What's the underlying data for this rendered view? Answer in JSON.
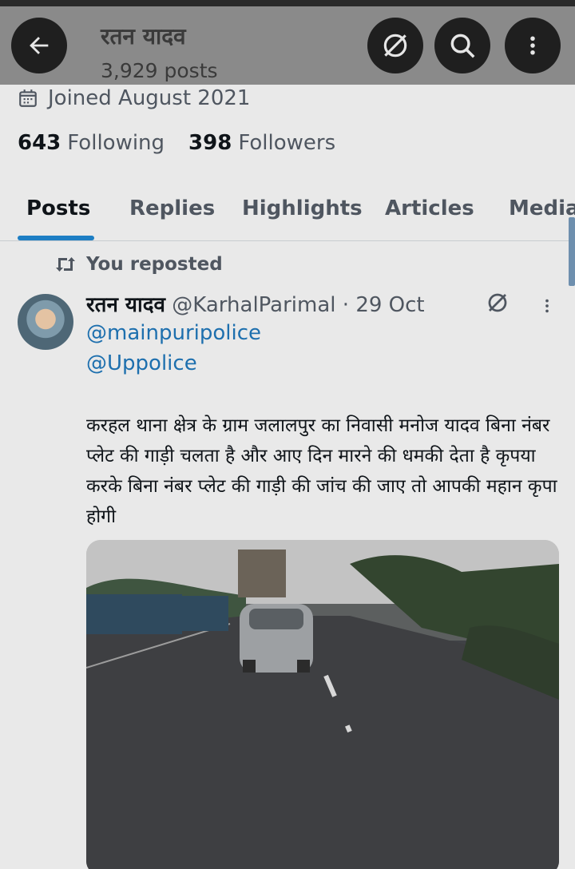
{
  "header": {
    "name": "रतन यादव",
    "posts_count": "3,929 posts"
  },
  "profile": {
    "joined": "Joined August 2021",
    "following_count": "643",
    "following_label": "Following",
    "followers_count": "398",
    "followers_label": "Followers"
  },
  "tabs": [
    {
      "label": "Posts",
      "active": true
    },
    {
      "label": "Replies"
    },
    {
      "label": "Highlights"
    },
    {
      "label": "Articles"
    },
    {
      "label": "Media"
    }
  ],
  "post": {
    "repost_label": "You reposted",
    "author_name": "रतन यादव",
    "author_handle": "@KarhalParimal",
    "separator": "·",
    "date": "29 Oct",
    "mentions": [
      "@mainpuripolice",
      "@Uppolice"
    ],
    "text": "करहल थाना क्षेत्र के ग्राम जलालपुर का निवासी मनोज यादव बिना नंबर प्लेट  की गाड़ी चलता है और आए दिन मारने  की धमकी देता है कृपया करके बिना नंबर प्लेट की गाड़ी की जांच की जाए तो आपकी महान कृपा होगी"
  },
  "colors": {
    "accent": "#1d7ec4",
    "link": "#1d6fae"
  },
  "icons": {
    "back": "arrow-left-icon",
    "grok": "no-sync-icon",
    "search": "search-icon",
    "more": "more-vertical-icon",
    "calendar": "calendar-icon",
    "repost": "repost-icon"
  }
}
